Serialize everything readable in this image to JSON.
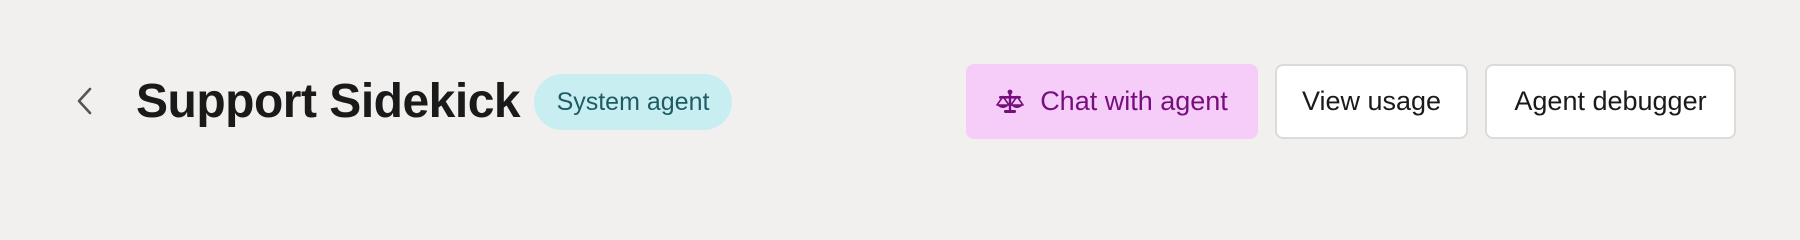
{
  "header": {
    "back_icon": "chevron-left-icon",
    "title": "Support Sidekick",
    "badge": "System agent",
    "badge_colors": {
      "background": "#c8eef2",
      "text": "#1d5c63"
    }
  },
  "actions": {
    "chat": {
      "label": "Chat with agent",
      "icon": "scales-icon",
      "background": "#f5cdf8",
      "color": "#760f7c"
    },
    "usage": {
      "label": "View usage"
    },
    "debugger": {
      "label": "Agent debugger"
    }
  }
}
